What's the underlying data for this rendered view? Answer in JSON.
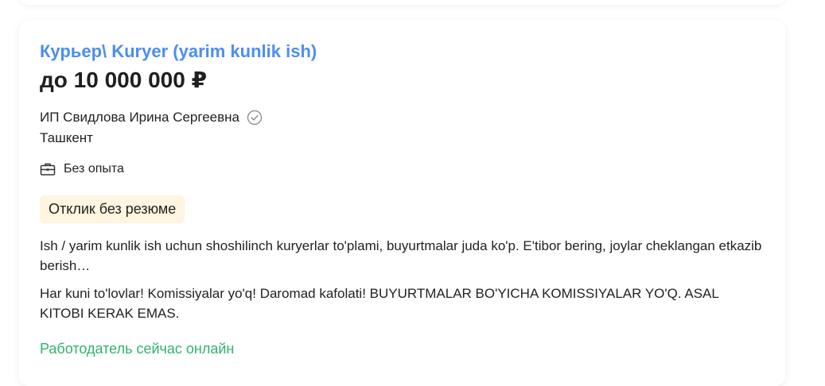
{
  "vacancy": {
    "title": "Курьер\\ Kuryer (yarim kunlik ish)",
    "salary": "до 10 000 000 ₽",
    "company": "ИП Свидлова Ирина Сергеевна",
    "city": "Ташкент",
    "experience": "Без опыта",
    "badge": "Отклик без резюме",
    "description_1": "Ish / yarim kunlik ish uchun shoshilinch kuryerlar to'plami, buyurtmalar juda ko'p. E'tibor bering, joylar cheklangan etkazib berish…",
    "description_2": "Har kuni to'lovlar! Komissiyalar yo'q! Daromad kafolati! BUYURTMALAR BO'YICHA KOMISSIYALAR YO'Q. ASAL KITOBI KERAK EMAS.",
    "online_status": "Работодатель сейчас онлайн"
  },
  "icons": {
    "verified": "check-circle-icon",
    "experience": "briefcase-icon"
  },
  "colors": {
    "title_link": "#4b8ef1",
    "online_status": "#2fb36b",
    "badge_background": "#fff5e0",
    "text": "#222222"
  }
}
